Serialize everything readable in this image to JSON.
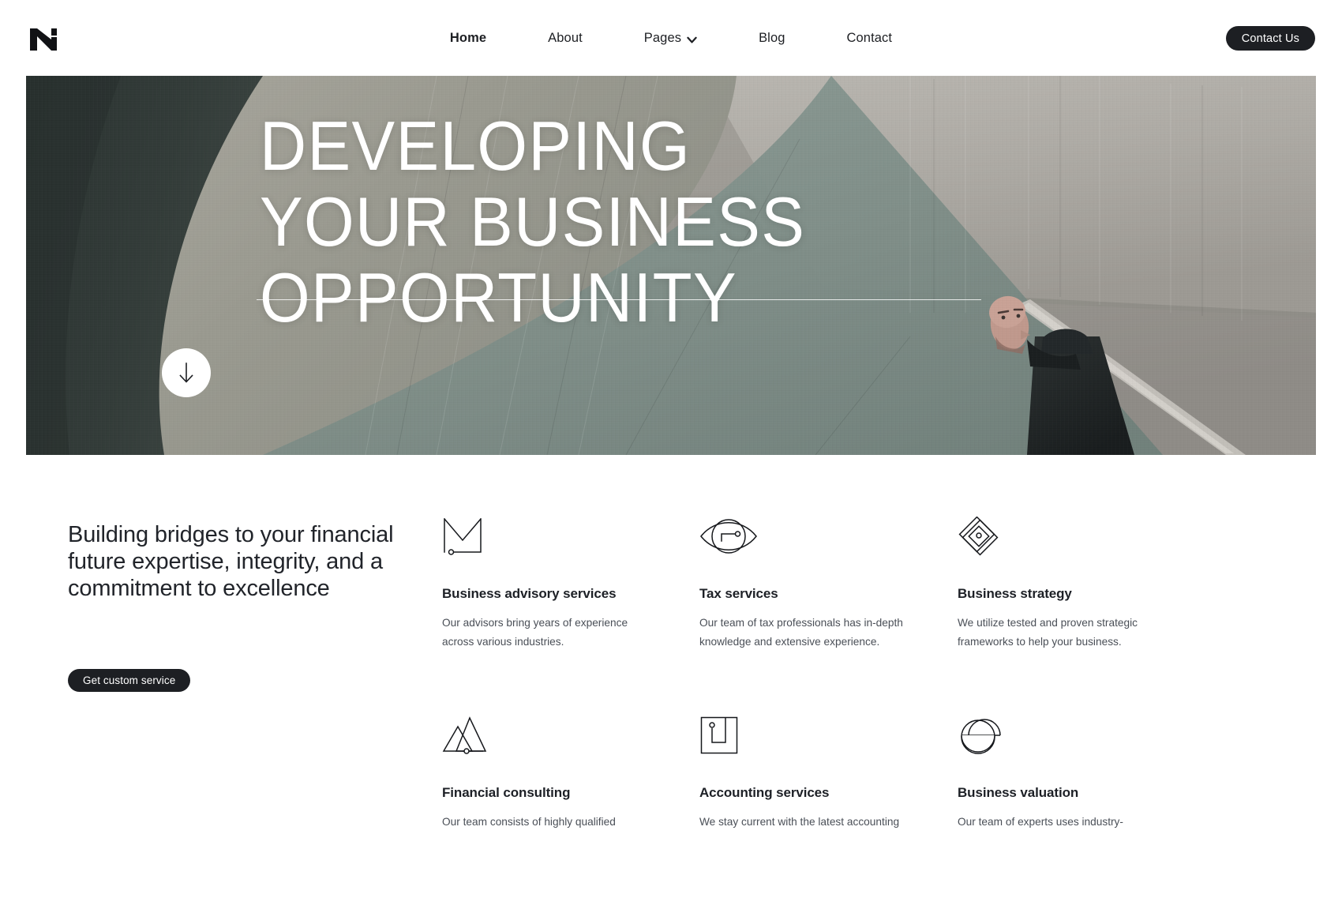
{
  "header": {
    "logo_name": "brand-logo-n",
    "nav": [
      {
        "label": "Home",
        "active": true,
        "has_dropdown": false
      },
      {
        "label": "About",
        "active": false,
        "has_dropdown": false
      },
      {
        "label": "Pages",
        "active": false,
        "has_dropdown": true
      },
      {
        "label": "Blog",
        "active": false,
        "has_dropdown": false
      },
      {
        "label": "Contact",
        "active": false,
        "has_dropdown": false
      }
    ],
    "cta_label": "Contact Us"
  },
  "hero": {
    "title_lines": [
      "DEVELOPING",
      "YOUR BUSINESS",
      "OPPORTUNITY"
    ],
    "scroll_icon": "arrow-down-icon",
    "image_alt": "Man standing beside a curved concrete wall looking upward"
  },
  "services": {
    "intro_heading": "Building bridges to your financial future expertise, integrity, and a commitment to excellence",
    "cta_label": "Get custom service",
    "cards": [
      {
        "icon": "crown-m-icon",
        "title": "Business advisory services",
        "desc": "Our advisors bring years of experience across various industries."
      },
      {
        "icon": "eye-icon",
        "title": "Tax services",
        "desc": "Our team of tax professionals has in-depth knowledge and extensive experience."
      },
      {
        "icon": "nested-diamond-icon",
        "title": "Business strategy",
        "desc": "We utilize tested and proven strategic frameworks to help your business."
      },
      {
        "icon": "mountains-icon",
        "title": "Financial consulting",
        "desc": "Our team consists of highly qualified"
      },
      {
        "icon": "square-panel-icon",
        "title": "Accounting services",
        "desc": "We stay current with the latest accounting"
      },
      {
        "icon": "arc-circle-icon",
        "title": "Business valuation",
        "desc": "Our team of experts uses industry-"
      }
    ]
  },
  "colors": {
    "ink": "#1d1f23",
    "body_text": "#4a4f57",
    "page_bg": "#ffffff",
    "hero_dark": "#313a38",
    "hero_mid": "#8d9086",
    "hero_light": "#b3b0ab",
    "hero_sage": "#7e8d88"
  }
}
